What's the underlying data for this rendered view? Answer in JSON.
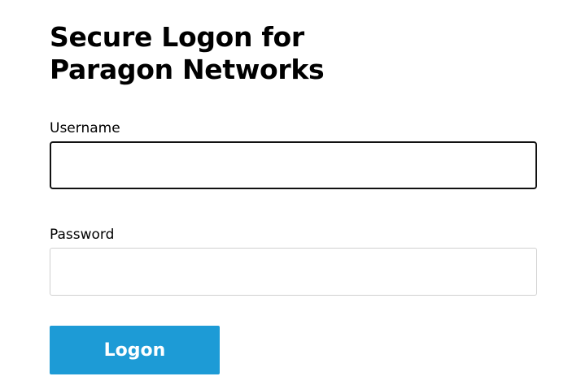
{
  "page": {
    "title": "Secure Logon for Paragon Networks"
  },
  "form": {
    "username": {
      "label": "Username",
      "value": "",
      "placeholder": ""
    },
    "password": {
      "label": "Password",
      "value": "",
      "placeholder": ""
    },
    "submit_label": "Logon"
  },
  "colors": {
    "button_bg": "#1d9bd6",
    "focus_border": "#111111",
    "input_border": "#d0d0d0"
  }
}
